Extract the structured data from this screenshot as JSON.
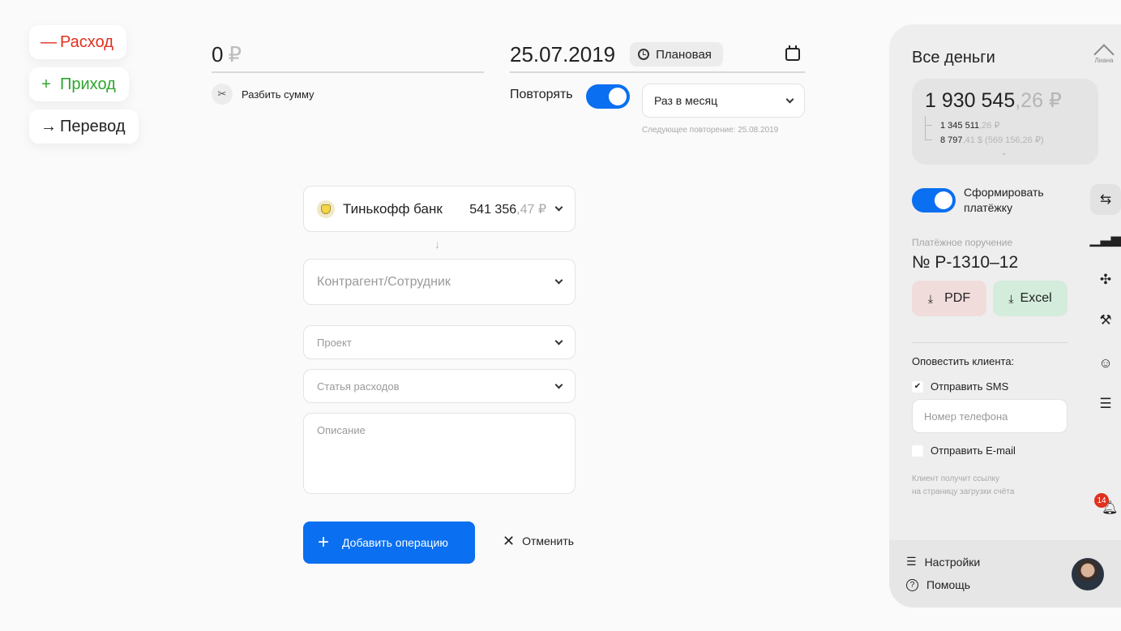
{
  "types": {
    "expense": {
      "symbol": "—",
      "label": "Расход"
    },
    "income": {
      "symbol": "+",
      "label": "Приход"
    },
    "transfer": {
      "symbol": "→",
      "label": "Перевод"
    }
  },
  "amount": {
    "value": "0",
    "currency": "₽"
  },
  "split": {
    "label": "Разбить сумму"
  },
  "date": {
    "value": "25.07.2019",
    "badge": "Плановая"
  },
  "repeat": {
    "label": "Повторять",
    "enabled": true,
    "frequency": "Раз в месяц",
    "next": "Следующее повторение: 25.08.2019"
  },
  "account": {
    "name": "Тинькофф банк",
    "amount_int": "541 356",
    "amount_frac": ",47 ₽"
  },
  "form": {
    "counterparty_placeholder": "Контрагент/Сотрудник",
    "project_placeholder": "Проект",
    "expense_item_placeholder": "Статья расходов",
    "description_placeholder": "Описание",
    "add_label": "Добавить операцию",
    "cancel_label": "Отменить"
  },
  "panel": {
    "title": "Все деньги",
    "logo_text": "Лиана",
    "balance_int": "1 930 545",
    "balance_frac": ",26 ₽",
    "sub1_int": "1 345 511",
    "sub1_frac": ",26 ₽",
    "sub2_int": "8 797",
    "sub2_frac": ",41 $ (569 156,26 ₽)",
    "form_toggle_label": "Сформировать платёжку",
    "pp_label": "Платёжное поручение",
    "pp_number": "№ Р-1310–12",
    "pdf_label": "PDF",
    "excel_label": "Excel",
    "notify_label": "Оповестить клиента:",
    "sms_label": "Отправить SMS",
    "sms_checked": true,
    "phone_placeholder": "Номер телефона",
    "email_label": "Отправить E-mail",
    "email_checked": false,
    "client_note_1": "Клиент получит ссылку",
    "client_note_2": "на страницу загрузки счёта",
    "notifications_count": "14",
    "settings_label": "Настройки",
    "help_label": "Помощь"
  },
  "side_icons": [
    "transfer-icon",
    "chart-icon",
    "grid-icon",
    "hammer-icon",
    "user-icon",
    "menu-icon"
  ],
  "colors": {
    "accent": "#0a6ff0",
    "expense": "#e0301e",
    "income": "#2ea52e",
    "pdf_bg": "#f1dcdc",
    "excel_bg": "#d4ecdc"
  }
}
